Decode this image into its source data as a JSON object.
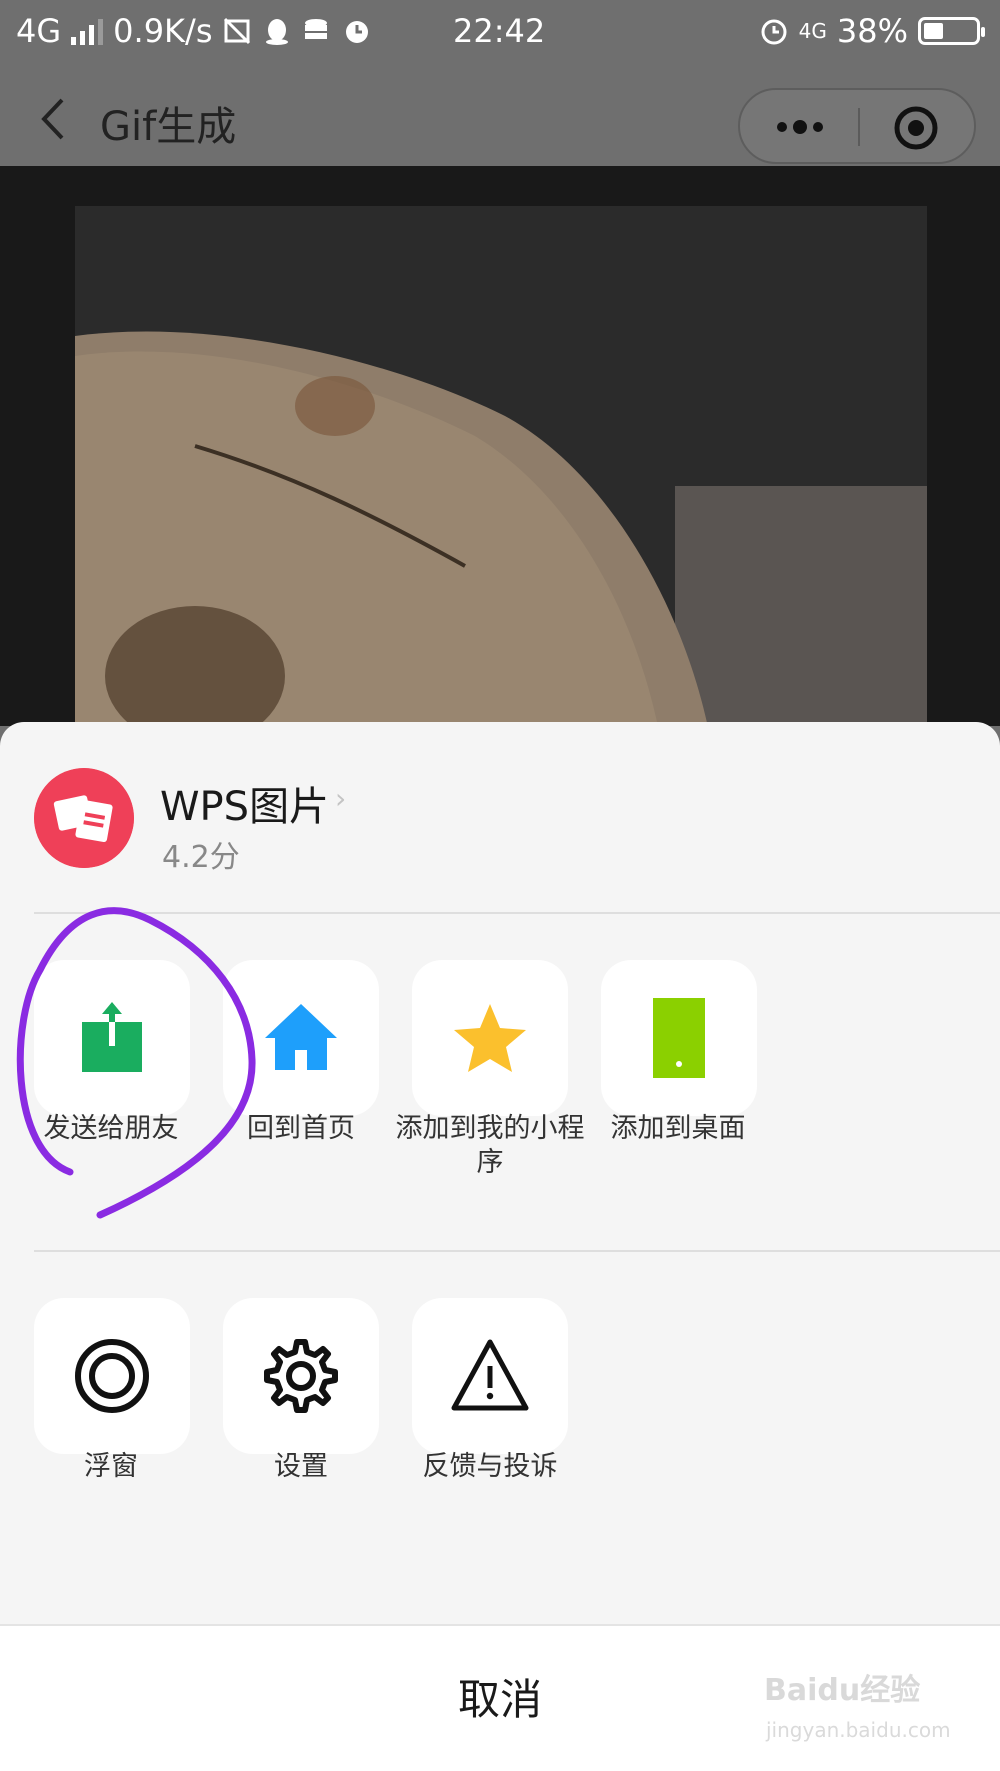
{
  "status_bar": {
    "network": "4G",
    "speed": "0.9K/s",
    "time": "22:42",
    "network_right": "4G",
    "battery": "38%",
    "battery_level": 0.38
  },
  "nav": {
    "title": "Gif生成"
  },
  "sheet": {
    "app": {
      "name": "WPS图片",
      "rating": "4.2分"
    },
    "row1": [
      {
        "label": "发送给朋友",
        "icon": "share-icon",
        "color": "#1aad5f"
      },
      {
        "label": "回到首页",
        "icon": "home-icon",
        "color": "#1e9ffb"
      },
      {
        "label": "添加到我的小程序",
        "icon": "star-icon",
        "color": "#fbc02d"
      },
      {
        "label": "添加到桌面",
        "icon": "phone-icon",
        "color": "#8bd000"
      }
    ],
    "row2": [
      {
        "label": "浮窗",
        "icon": "float-window-icon"
      },
      {
        "label": "设置",
        "icon": "gear-icon"
      },
      {
        "label": "反馈与投诉",
        "icon": "warning-icon"
      }
    ],
    "cancel": "取消"
  },
  "watermark": {
    "brand": "Baidu经验",
    "url": "jingyan.baidu.com"
  },
  "colors": {
    "annotation": "#8a2be2",
    "overlay": "#6f6f6f"
  }
}
